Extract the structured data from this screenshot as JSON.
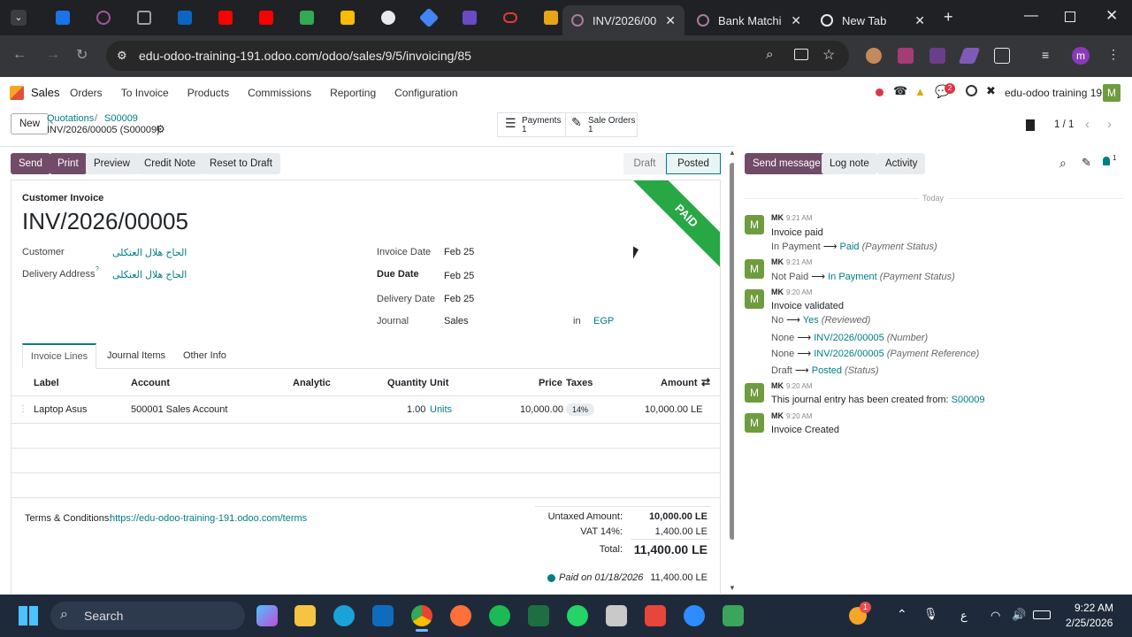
{
  "browser": {
    "tabs": [
      {
        "label": "INV/2026/00"
      },
      {
        "label": "Bank Matchi"
      },
      {
        "label": "New Tab"
      }
    ],
    "url": "edu-odoo-training-191.odoo.com/odoo/sales/9/5/invoicing/85",
    "profile_initial": "m"
  },
  "app": {
    "name": "Sales",
    "menu": [
      "Orders",
      "To Invoice",
      "Products",
      "Commissions",
      "Reporting",
      "Configuration"
    ],
    "chat_badge": "2",
    "company": "edu-odoo training 19",
    "user_initial": "M"
  },
  "control": {
    "new_label": "New",
    "breadcrumb_1": "Quotations",
    "breadcrumb_sep": "/",
    "breadcrumb_2": "S00009",
    "record_title": "INV/2026/00005 (S00009)",
    "payments_label": "Payments",
    "payments_count": "1",
    "sale_orders_label": "Sale Orders",
    "sale_orders_count": "1",
    "pager": "1 / 1"
  },
  "actions": {
    "send": "Send",
    "print": "Print",
    "preview": "Preview",
    "credit_note": "Credit Note",
    "reset": "Reset to Draft",
    "status_draft": "Draft",
    "status_posted": "Posted"
  },
  "invoice": {
    "type_label": "Customer Invoice",
    "number": "INV/2026/00005",
    "ribbon": "PAID",
    "customer_label": "Customer",
    "customer_value": "الحاج هلال العتكلى",
    "delivery_address_label": "Delivery Address",
    "delivery_address_value": "الحاج هلال العتكلى",
    "tooltip_mark": "?",
    "invoice_date_label": "Invoice Date",
    "invoice_date": "Feb 25",
    "due_date_label": "Due Date",
    "due_date": "Feb 25",
    "delivery_date_label": "Delivery Date",
    "delivery_date": "Feb 25",
    "journal_label": "Journal",
    "journal": "Sales",
    "in_label": "in",
    "currency": "EGP"
  },
  "tabs": [
    "Invoice Lines",
    "Journal Items",
    "Other Info"
  ],
  "lines": {
    "headers": {
      "label": "Label",
      "account": "Account",
      "analytic": "Analytic",
      "quantity": "Quantity",
      "unit": "Unit",
      "price": "Price",
      "taxes": "Taxes",
      "amount": "Amount"
    },
    "rows": [
      {
        "label": "Laptop Asus",
        "account": "500001 Sales Account",
        "analytic": "",
        "quantity": "1.00",
        "unit": "Units",
        "price": "10,000.00",
        "tax": "14%",
        "amount": "10,000.00 LE"
      }
    ]
  },
  "totals": {
    "terms_label": "Terms & Conditions:",
    "terms_link": "https://edu-odoo-training-191.odoo.com/terms",
    "untaxed_label": "Untaxed Amount:",
    "untaxed": "10,000.00 LE",
    "vat_label": "VAT 14%:",
    "vat": "1,400.00 LE",
    "total_label": "Total:",
    "total": "11,400.00 LE",
    "paid_label": "Paid on 01/18/2026",
    "paid_amount": "11,400.00 LE"
  },
  "chatter": {
    "send_message": "Send message",
    "log_note": "Log note",
    "activity": "Activity",
    "followers_count": "1",
    "date_sep": "Today",
    "messages": [
      {
        "author": "MK",
        "time": "9:21 AM",
        "body": "Invoice paid",
        "changes": [
          {
            "old": "In Payment",
            "new": "Paid",
            "field": "(Payment Status)"
          }
        ]
      },
      {
        "author": "MK",
        "time": "9:21 AM",
        "body": "",
        "changes": [
          {
            "old": "Not Paid",
            "new": "In Payment",
            "field": "(Payment Status)"
          }
        ]
      },
      {
        "author": "MK",
        "time": "9:20 AM",
        "body": "Invoice validated",
        "changes": [
          {
            "old": "No",
            "new": "Yes",
            "field": "(Reviewed)"
          },
          {
            "old": "None",
            "new": "INV/2026/00005",
            "field": "(Number)"
          },
          {
            "old": "None",
            "new": "INV/2026/00005",
            "field": "(Payment Reference)"
          },
          {
            "old": "Draft",
            "new": "Posted",
            "field": "(Status)"
          }
        ]
      },
      {
        "author": "MK",
        "time": "9:20 AM",
        "body": "This journal entry has been created from:",
        "link": "S00009",
        "changes": []
      },
      {
        "author": "MK",
        "time": "9:20 AM",
        "body": "Invoice Created",
        "changes": []
      }
    ]
  },
  "taskbar": {
    "search": "Search",
    "lang": "ع",
    "time": "9:22 AM",
    "date": "2/25/2026",
    "badge": "1"
  },
  "colors": {
    "brand": "#714b67",
    "link": "#017e84",
    "paid_ribbon": "#28a745",
    "avatar": "#6f9c3f"
  }
}
